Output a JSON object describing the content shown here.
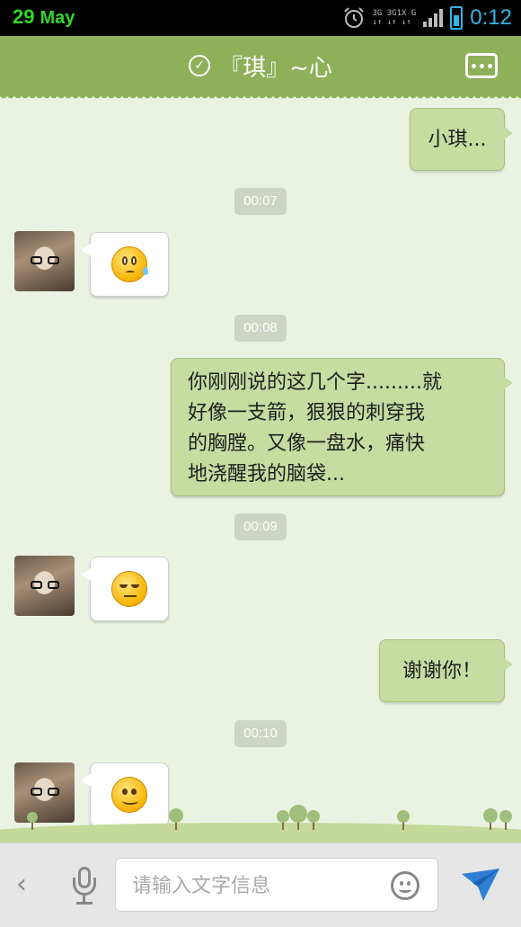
{
  "status_bar": {
    "day": "29",
    "month": "May",
    "time": "0:12",
    "network_top": "3G 3G1X G",
    "network_bottom": "↓↑ ↓↑ ↓↑"
  },
  "header": {
    "title": "『琪』~心",
    "verified_icon": "check-circle-icon",
    "more_icon": "more-dots-icon"
  },
  "messages": [
    {
      "type": "out",
      "text": "小琪..."
    },
    {
      "type": "timestamp",
      "text": "00:07"
    },
    {
      "type": "in",
      "emoji": "sweat-emoji"
    },
    {
      "type": "timestamp",
      "text": "00:08"
    },
    {
      "type": "out",
      "lines": [
        "你刚刚说的这几个字.........就",
        "好像一支箭，狠狠的刺穿我",
        "的胸膛。又像一盘水，痛快",
        "地浇醒我的脑袋..."
      ]
    },
    {
      "type": "timestamp",
      "text": "00:09"
    },
    {
      "type": "in",
      "emoji": "unamused-emoji"
    },
    {
      "type": "out",
      "text": "谢谢你！"
    },
    {
      "type": "timestamp",
      "text": "00:10"
    },
    {
      "type": "in",
      "emoji": "smile-emoji"
    }
  ],
  "input_bar": {
    "back_icon": "chevron-left-icon",
    "voice_icon": "microphone-icon",
    "placeholder": "请输入文字信息",
    "value": "",
    "emoji_icon": "smiley-icon",
    "send_icon": "send-arrow-icon"
  },
  "colors": {
    "header_bg": "#8db059",
    "chat_bg": "#eaf3e2",
    "outgoing_bubble": "#c6dca1",
    "incoming_bubble": "#ffffff",
    "time_color": "#33b5e5",
    "date_color": "#2fd62a"
  }
}
